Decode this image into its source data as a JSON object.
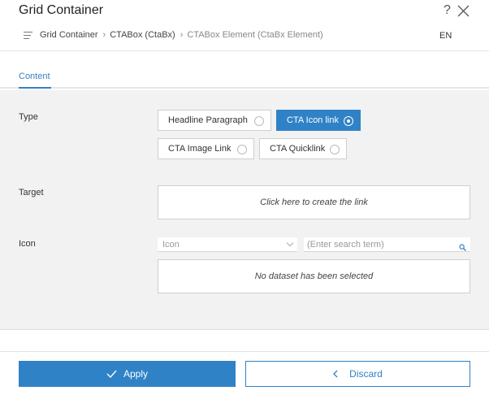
{
  "header": {
    "title": "Grid Container",
    "help": "?",
    "breadcrumbs": [
      "Grid Container",
      "CTABox (CtaBx)",
      "CTABox Element (CtaBx Element)"
    ],
    "separator": "›",
    "language": "EN"
  },
  "tabs": [
    {
      "label": "Content",
      "active": true
    }
  ],
  "form": {
    "type": {
      "label": "Type",
      "options": [
        {
          "label": "Headline Paragraph",
          "selected": false
        },
        {
          "label": "CTA Icon link",
          "selected": true
        },
        {
          "label": "CTA Image Link",
          "selected": false
        },
        {
          "label": "CTA Quicklink",
          "selected": false
        }
      ]
    },
    "target": {
      "label": "Target",
      "placeholder": "Click here to create the link"
    },
    "icon": {
      "label": "Icon",
      "select_value": "Icon",
      "search_placeholder": "(Enter search term)",
      "dataset_message": "No dataset has been selected"
    }
  },
  "footer": {
    "apply_label": "Apply",
    "discard_label": "Discard"
  },
  "colors": {
    "accent": "#2f82c6",
    "panel_background": "#f2f2f2"
  }
}
